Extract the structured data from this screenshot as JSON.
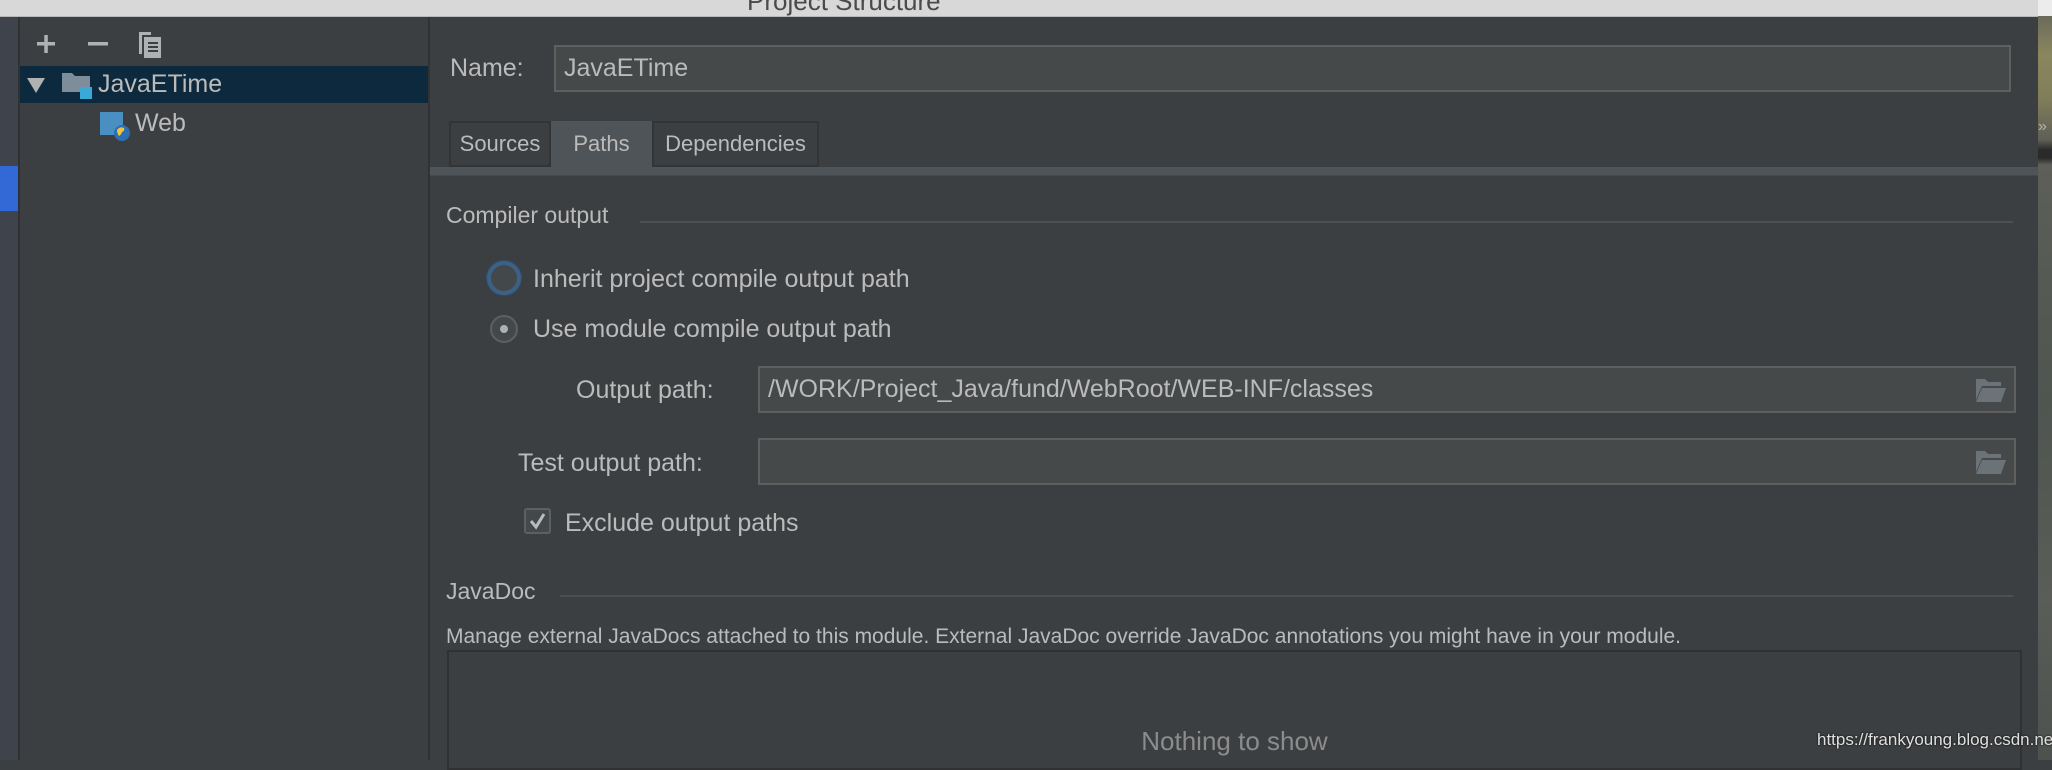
{
  "window": {
    "title": "Project Structure"
  },
  "left_panel": {
    "toolbar": [
      {
        "name": "add",
        "icon": "plus-icon",
        "glyph": "+"
      },
      {
        "name": "remove",
        "icon": "minus-icon",
        "glyph": "−"
      },
      {
        "name": "copy",
        "icon": "copy-icon",
        "glyph": "⧉"
      }
    ],
    "tree": [
      {
        "label": "JavaETime",
        "icon": "module-folder-icon",
        "expanded": true,
        "selected": true,
        "level": 0
      },
      {
        "label": "Web",
        "icon": "web-facet-icon",
        "selected": false,
        "level": 1
      }
    ]
  },
  "main": {
    "name_label": "Name:",
    "name_value": "JavaETime",
    "tabs": [
      {
        "label": "Sources",
        "active": false
      },
      {
        "label": "Paths",
        "active": true
      },
      {
        "label": "Dependencies",
        "active": false
      }
    ],
    "compiler_output": {
      "title": "Compiler output",
      "radio_inherit": {
        "label": "Inherit project compile output path",
        "checked": false,
        "focused": true
      },
      "radio_module": {
        "label": "Use module compile output path",
        "checked": true
      },
      "output_path_label": "Output path:",
      "output_path_value": "/WORK/Project_Java/fund/WebRoot/WEB-INF/classes",
      "test_output_path_label": "Test output path:",
      "test_output_path_value": "",
      "exclude_label": "Exclude output paths",
      "exclude_checked": true
    },
    "javadoc": {
      "title": "JavaDoc",
      "description": "Manage external JavaDocs attached to this module. External JavaDoc override JavaDoc annotations you might have in your module.",
      "empty_text": "Nothing to show"
    }
  },
  "overlay": {
    "watermark": "https://frankyoung.blog.csdn.net",
    "desktop_chevron": "»"
  },
  "colors": {
    "background": "#3c3f41",
    "selection": "#0d293e",
    "accent_blue": "#3369d6",
    "focus_ring": "#3d6185",
    "text": "#bbbbbb"
  }
}
